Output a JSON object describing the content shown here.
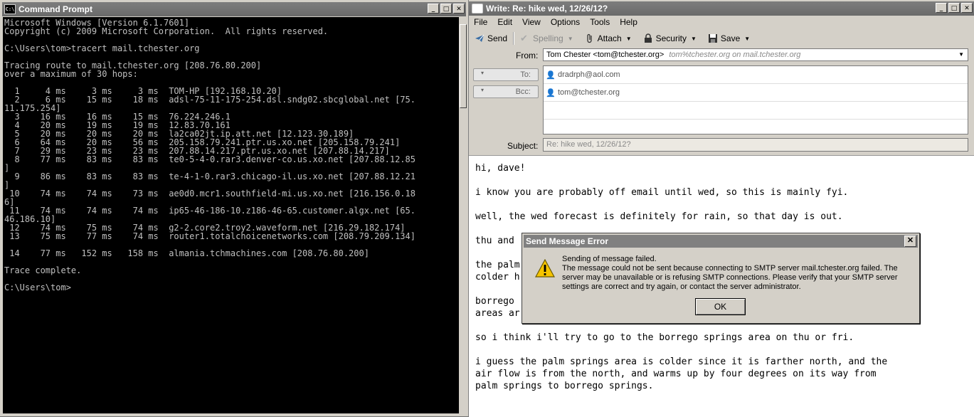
{
  "cmd": {
    "title": "Command Prompt",
    "lines": [
      "Microsoft Windows [Version 6.1.7601]",
      "Copyright (c) 2009 Microsoft Corporation.  All rights reserved.",
      "",
      "C:\\Users\\tom>tracert mail.tchester.org",
      "",
      "Tracing route to mail.tchester.org [208.76.80.200]",
      "over a maximum of 30 hops:",
      "",
      "  1     4 ms     3 ms     3 ms  TOM-HP [192.168.10.20]",
      "  2     6 ms    15 ms    18 ms  adsl-75-11-175-254.dsl.sndg02.sbcglobal.net [75.",
      "11.175.254]",
      "  3    16 ms    16 ms    15 ms  76.224.246.1",
      "  4    20 ms    19 ms    19 ms  12.83.70.161",
      "  5    20 ms    20 ms    20 ms  la2ca02jt.ip.att.net [12.123.30.189]",
      "  6    64 ms    20 ms    56 ms  205.158.79.241.ptr.us.xo.net [205.158.79.241]",
      "  7    29 ms    23 ms    23 ms  207.88.14.217.ptr.us.xo.net [207.88.14.217]",
      "  8    77 ms    83 ms    83 ms  te0-5-4-0.rar3.denver-co.us.xo.net [207.88.12.85",
      "]",
      "  9    86 ms    83 ms    83 ms  te-4-1-0.rar3.chicago-il.us.xo.net [207.88.12.21",
      "]",
      " 10    74 ms    74 ms    73 ms  ae0d0.mcr1.southfield-mi.us.xo.net [216.156.0.18",
      "6]",
      " 11    74 ms    74 ms    74 ms  ip65-46-186-10.z186-46-65.customer.algx.net [65.",
      "46.186.10]",
      " 12    74 ms    75 ms    74 ms  g2-2.core2.troy2.waveform.net [216.29.182.174]",
      " 13    75 ms    77 ms    74 ms  router1.totalchoicenetworks.com [208.79.209.134]",
      "",
      " 14    77 ms   152 ms   158 ms  almania.tchmachines.com [208.76.80.200]",
      "",
      "Trace complete.",
      "",
      "C:\\Users\\tom>"
    ]
  },
  "compose": {
    "title": "Write: Re: hike wed, 12/26/12?",
    "menu": [
      "File",
      "Edit",
      "View",
      "Options",
      "Tools",
      "Help"
    ],
    "toolbar": {
      "send": "Send",
      "spelling": "Spelling",
      "attach": "Attach",
      "security": "Security",
      "save": "Save"
    },
    "from_label": "From:",
    "from_value": "Tom Chester <tom@tchester.org>",
    "from_note": "tom%tchester.org on mail.tchester.org",
    "to_label": "To:",
    "to_value": "dradrph@aol.com",
    "bcc_label": "Bcc:",
    "bcc_value": "tom@tchester.org",
    "subject_label": "Subject:",
    "subject_value": "Re: hike wed, 12/26/12?",
    "body": {
      "l1": "hi, dave!",
      "l2": "i know you are probably off email until wed, so this is mainly fyi.",
      "l3": "well, the wed forecast is definitely for rain, so that day is out.",
      "l4": "thu and",
      "l5a": "the palm",
      "l5b": "colder h",
      "l6a": "borrego",
      "l6b": "areas ar",
      "l7": "so i think i'll try to go to the borrego springs area on thu or fri.",
      "l8a": "i guess the palm springs area is colder since it is farther north, and the",
      "l8b": "air flow is from the north, and warms up by four degrees on its way from",
      "l8c": "palm springs to borrego springs."
    }
  },
  "dialog": {
    "title": "Send Message Error",
    "line1": "Sending of message failed.",
    "line2": "The message could not be sent because connecting to SMTP server mail.tchester.org failed. The server may be unavailable or is refusing SMTP connections. Please verify that your SMTP server settings are correct and try again, or contact the server administrator.",
    "ok": "OK"
  }
}
